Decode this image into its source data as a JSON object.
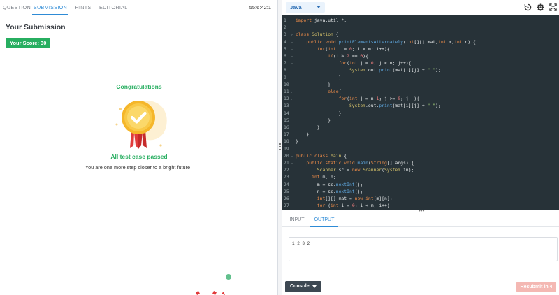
{
  "left_tabs": [
    "QUESTION",
    "SUBMISSION",
    "HINTS",
    "EDITORIAL"
  ],
  "timer": "55:6:42:1",
  "submission": {
    "title": "Your Submission",
    "score": "Your Score: 30",
    "congrats": "Congratulations",
    "passed": "All test case passed",
    "tagline": "You are one more step closer to a bright future"
  },
  "editor": {
    "language": "Java",
    "lines": [
      {
        "n": "1",
        "fold": false
      },
      {
        "n": "2",
        "fold": false
      },
      {
        "n": "3",
        "fold": true
      },
      {
        "n": "4",
        "fold": true
      },
      {
        "n": "5",
        "fold": true
      },
      {
        "n": "6",
        "fold": true
      },
      {
        "n": "7",
        "fold": true
      },
      {
        "n": "8",
        "fold": false
      },
      {
        "n": "9",
        "fold": false
      },
      {
        "n": "10",
        "fold": false
      },
      {
        "n": "11",
        "fold": true
      },
      {
        "n": "12",
        "fold": true
      },
      {
        "n": "13",
        "fold": false
      },
      {
        "n": "14",
        "fold": false
      },
      {
        "n": "15",
        "fold": false
      },
      {
        "n": "16",
        "fold": false
      },
      {
        "n": "17",
        "fold": false
      },
      {
        "n": "18",
        "fold": false
      },
      {
        "n": "19",
        "fold": false
      },
      {
        "n": "20",
        "fold": true
      },
      {
        "n": "21",
        "fold": true
      },
      {
        "n": "22",
        "fold": false
      },
      {
        "n": "23",
        "fold": false
      },
      {
        "n": "24",
        "fold": false
      },
      {
        "n": "25",
        "fold": false
      },
      {
        "n": "26",
        "fold": false
      },
      {
        "n": "27",
        "fold": false
      }
    ],
    "code": [
      "import java.util.*;",
      "",
      "class Solution {",
      "    public void printElementsAlternately(int[][] mat,int m,int n) {",
      "        for(int i = 0; i < m; i++){",
      "            if(i % 2 == 0){",
      "                for(int j = 0; j < n; j++){",
      "                    System.out.print(mat[i][j] + \" \");",
      "                }",
      "            }",
      "            else{",
      "                for(int j = n-1; j >= 0; j--){",
      "                    System.out.print(mat[i][j] + \" \");",
      "                }",
      "            }",
      "        }",
      "    }",
      "}",
      "",
      "public class Main {",
      "    public static void main(String[] args) {",
      "        Scanner sc = new Scanner(System.in);",
      "      int m, n;",
      "        m = sc.nextInt();",
      "        n = sc.nextInt();",
      "        int[][] mat = new int[m][n];",
      "        for (int i = 0; i < m; i++)"
    ]
  },
  "io_tabs": [
    "INPUT",
    "OUTPUT"
  ],
  "output": "1 2 3 2",
  "console_label": "Console",
  "resubmit_label": "Resubmit in 4",
  "colors": {
    "accent": "#2e8bd6",
    "success": "#27ae60",
    "editor_bg": "#273238",
    "resubmit": "#f4b8b3"
  }
}
